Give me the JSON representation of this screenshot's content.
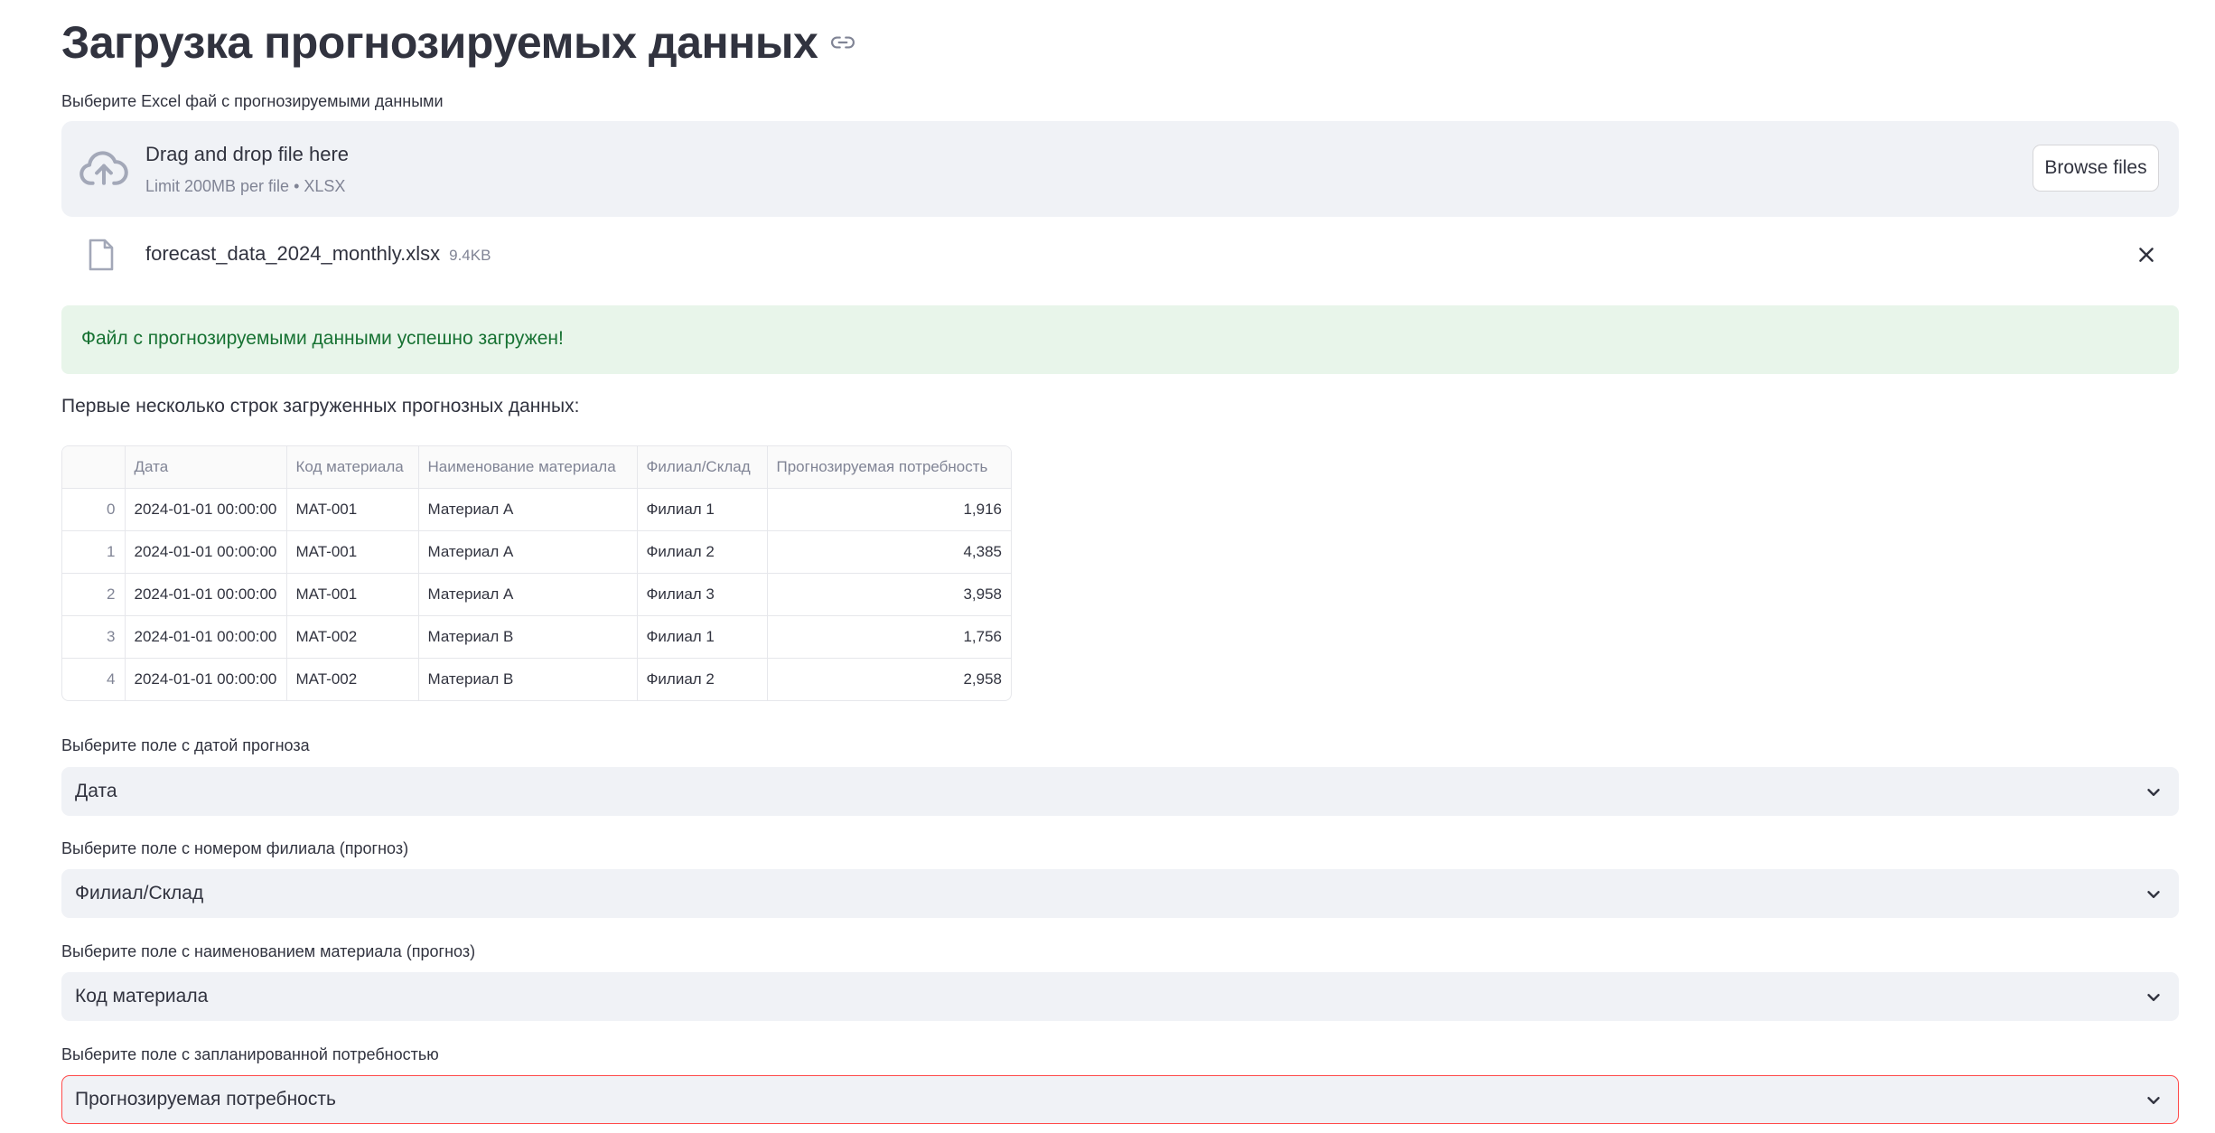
{
  "page": {
    "title": "Загрузка прогнозируемых данных"
  },
  "uploader": {
    "label": "Выберите Excel фай с прогнозируемыми данными",
    "drop_title": "Drag and drop file here",
    "drop_limit": "Limit 200MB per file • XLSX",
    "browse_label": "Browse files"
  },
  "file": {
    "name": "forecast_data_2024_monthly.xlsx",
    "size": "9.4KB"
  },
  "alert": {
    "text": "Файл с прогнозируемыми данными успешно загружен!"
  },
  "preview": {
    "caption": "Первые несколько строк загруженных прогнозных данных:",
    "columns": [
      "",
      "Дата",
      "Код материала",
      "Наименование материала",
      "Филиал/Склад",
      "Прогнозируемая потребность"
    ],
    "rows": [
      [
        "0",
        "2024-01-01 00:00:00",
        "MAT-001",
        "Материал A",
        "Филиал 1",
        "1,916"
      ],
      [
        "1",
        "2024-01-01 00:00:00",
        "MAT-001",
        "Материал A",
        "Филиал 2",
        "4,385"
      ],
      [
        "2",
        "2024-01-01 00:00:00",
        "MAT-001",
        "Материал A",
        "Филиал 3",
        "3,958"
      ],
      [
        "3",
        "2024-01-01 00:00:00",
        "MAT-002",
        "Материал B",
        "Филиал 1",
        "1,756"
      ],
      [
        "4",
        "2024-01-01 00:00:00",
        "MAT-002",
        "Материал B",
        "Филиал 2",
        "2,958"
      ]
    ]
  },
  "selects": [
    {
      "label": "Выберите поле с датой прогноза",
      "value": "Дата"
    },
    {
      "label": "Выберите поле с номером филиала (прогноз)",
      "value": "Филиал/Склад"
    },
    {
      "label": "Выберите поле с наименованием материала (прогноз)",
      "value": "Код материала"
    },
    {
      "label": "Выберите поле с запланированной потребностью",
      "value": "Прогнозируемая потребность"
    }
  ],
  "icons": {
    "title_link": "link-icon",
    "uploader": "cloud-upload-icon",
    "file": "file-icon",
    "remove_file": "close-icon",
    "select_caret": "chevron-down-icon"
  },
  "colors": {
    "success_bg": "#e8f5ea",
    "success_text": "#177233",
    "error_border": "#ff4b4b",
    "input_bg": "#f0f2f6"
  }
}
